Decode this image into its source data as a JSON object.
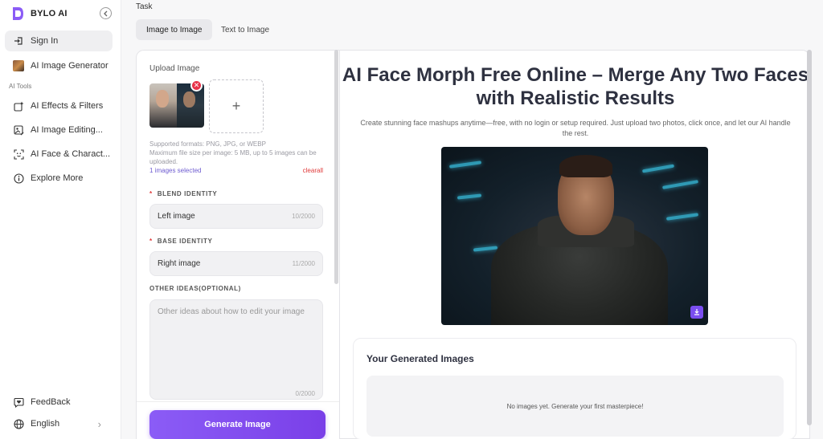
{
  "brand": {
    "name": "BYLO AI",
    "logo_color": "#8b5cf6"
  },
  "sidebar": {
    "sign_in": "Sign In",
    "generator": "AI Image Generator",
    "section_label": "AI Tools",
    "items": [
      {
        "label": "AI Effects & Filters",
        "icon": "sparkle-grid-icon"
      },
      {
        "label": "AI Image Editing...",
        "icon": "image-edit-icon"
      },
      {
        "label": "AI Face & Charact...",
        "icon": "face-scan-icon"
      },
      {
        "label": "Explore More",
        "icon": "info-circle-icon"
      }
    ],
    "feedback": "FeedBack",
    "language": "English"
  },
  "task": {
    "label": "Task",
    "tabs": [
      {
        "label": "Image to Image",
        "active": true
      },
      {
        "label": "Text to Image",
        "active": false
      }
    ]
  },
  "form": {
    "upload_title": "Upload Image",
    "formats_note": "Supported formats: PNG, JPG, or WEBP",
    "size_note": "Maximum file size per image: 5 MB, up to 5 images can be uploaded.",
    "selected_count": "1 images selected",
    "clear_all": "clearall",
    "blend_label": "BLEND IDENTITY",
    "blend_value": "Left image",
    "blend_count": "10/2000",
    "base_label": "BASE IDENTITY",
    "base_value": "Right image",
    "base_count": "11/2000",
    "other_label": "OTHER IDEAS(OPTIONAL)",
    "other_placeholder": "Other ideas about how to edit your image",
    "other_count": "0/2000",
    "required_mark": "*",
    "generate_button": "Generate Image",
    "add_symbol": "+"
  },
  "main": {
    "title": "AI Face Morph Free Online – Merge Any Two Faces with Realistic Results",
    "subtitle": "Create stunning face mashups anytime—free, with no login or setup required. Just upload two photos, click once, and let our AI handle the rest.",
    "generated_title": "Your Generated Images",
    "empty_text": "No images yet. Generate your first masterpiece!"
  },
  "colors": {
    "accent": "#8b5cf6",
    "danger": "#e03a3a"
  }
}
